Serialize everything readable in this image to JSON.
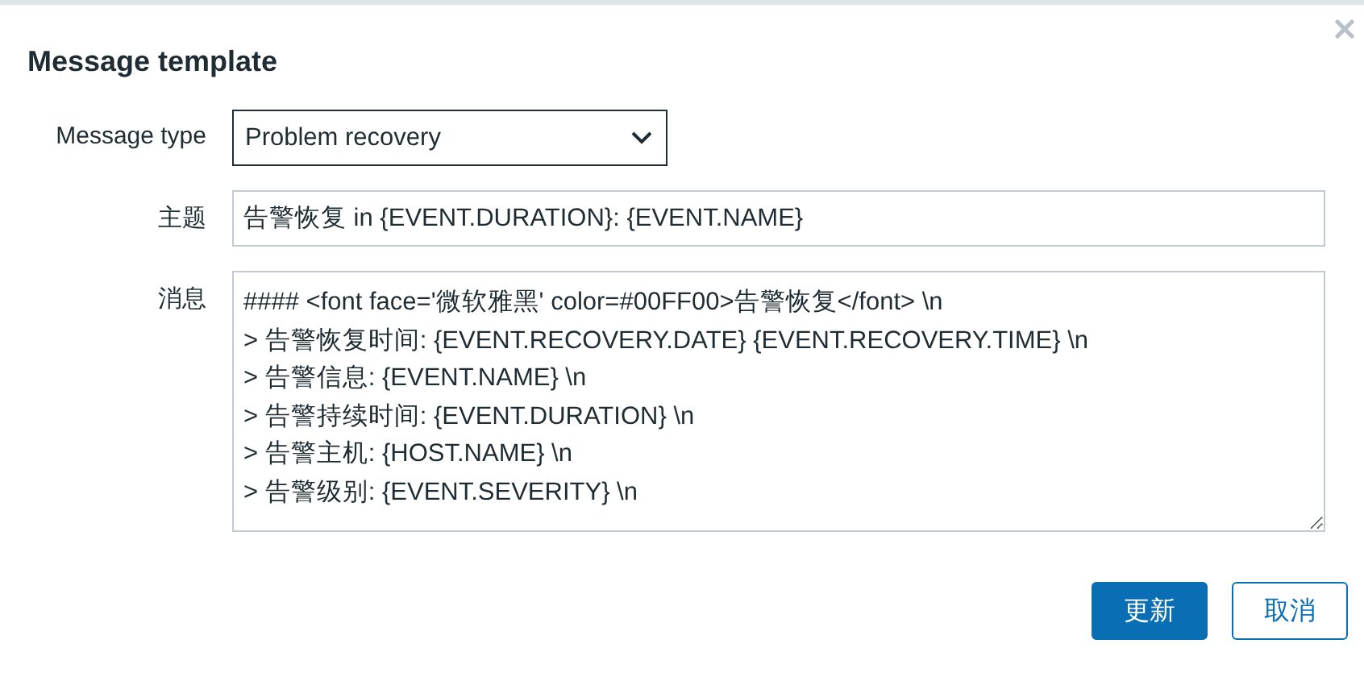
{
  "window": {
    "title": "Message template"
  },
  "form": {
    "fields": [
      {
        "kind": "select",
        "label": "Message type",
        "value": "Problem recovery"
      },
      {
        "kind": "input",
        "label": "主题",
        "value": "告警恢复 in {EVENT.DURATION}: {EVENT.NAME}"
      },
      {
        "kind": "textarea",
        "label": "消息",
        "lines": [
          "#### <font face='微软雅黑' color=#00FF00>告警恢复</font> \\n",
          "> 告警恢复时间: {EVENT.RECOVERY.DATE} {EVENT.RECOVERY.TIME} \\n",
          "> 告警信息: {EVENT.NAME} \\n",
          "> 告警持续时间: {EVENT.DURATION} \\n",
          "> 告警主机: {HOST.NAME} \\n",
          "> 告警级别: {EVENT.SEVERITY} \\n"
        ]
      }
    ]
  },
  "buttons": [
    {
      "label": "更新",
      "kind": "primary"
    },
    {
      "label": "取消",
      "kind": "secondary"
    }
  ]
}
